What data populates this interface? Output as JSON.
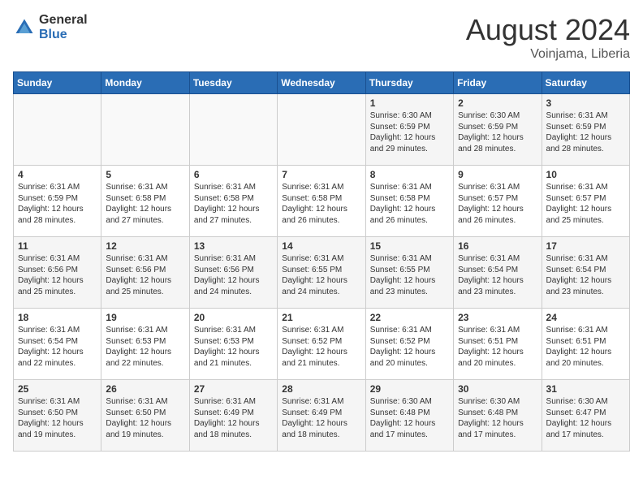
{
  "header": {
    "logo_general": "General",
    "logo_blue": "Blue",
    "title": "August 2024",
    "subtitle": "Voinjama, Liberia"
  },
  "calendar": {
    "days_of_week": [
      "Sunday",
      "Monday",
      "Tuesday",
      "Wednesday",
      "Thursday",
      "Friday",
      "Saturday"
    ],
    "weeks": [
      [
        {
          "day": "",
          "info": ""
        },
        {
          "day": "",
          "info": ""
        },
        {
          "day": "",
          "info": ""
        },
        {
          "day": "",
          "info": ""
        },
        {
          "day": "1",
          "info": "Sunrise: 6:30 AM\nSunset: 6:59 PM\nDaylight: 12 hours\nand 29 minutes."
        },
        {
          "day": "2",
          "info": "Sunrise: 6:30 AM\nSunset: 6:59 PM\nDaylight: 12 hours\nand 28 minutes."
        },
        {
          "day": "3",
          "info": "Sunrise: 6:31 AM\nSunset: 6:59 PM\nDaylight: 12 hours\nand 28 minutes."
        }
      ],
      [
        {
          "day": "4",
          "info": "Sunrise: 6:31 AM\nSunset: 6:59 PM\nDaylight: 12 hours\nand 28 minutes."
        },
        {
          "day": "5",
          "info": "Sunrise: 6:31 AM\nSunset: 6:58 PM\nDaylight: 12 hours\nand 27 minutes."
        },
        {
          "day": "6",
          "info": "Sunrise: 6:31 AM\nSunset: 6:58 PM\nDaylight: 12 hours\nand 27 minutes."
        },
        {
          "day": "7",
          "info": "Sunrise: 6:31 AM\nSunset: 6:58 PM\nDaylight: 12 hours\nand 26 minutes."
        },
        {
          "day": "8",
          "info": "Sunrise: 6:31 AM\nSunset: 6:58 PM\nDaylight: 12 hours\nand 26 minutes."
        },
        {
          "day": "9",
          "info": "Sunrise: 6:31 AM\nSunset: 6:57 PM\nDaylight: 12 hours\nand 26 minutes."
        },
        {
          "day": "10",
          "info": "Sunrise: 6:31 AM\nSunset: 6:57 PM\nDaylight: 12 hours\nand 25 minutes."
        }
      ],
      [
        {
          "day": "11",
          "info": "Sunrise: 6:31 AM\nSunset: 6:56 PM\nDaylight: 12 hours\nand 25 minutes."
        },
        {
          "day": "12",
          "info": "Sunrise: 6:31 AM\nSunset: 6:56 PM\nDaylight: 12 hours\nand 25 minutes."
        },
        {
          "day": "13",
          "info": "Sunrise: 6:31 AM\nSunset: 6:56 PM\nDaylight: 12 hours\nand 24 minutes."
        },
        {
          "day": "14",
          "info": "Sunrise: 6:31 AM\nSunset: 6:55 PM\nDaylight: 12 hours\nand 24 minutes."
        },
        {
          "day": "15",
          "info": "Sunrise: 6:31 AM\nSunset: 6:55 PM\nDaylight: 12 hours\nand 23 minutes."
        },
        {
          "day": "16",
          "info": "Sunrise: 6:31 AM\nSunset: 6:54 PM\nDaylight: 12 hours\nand 23 minutes."
        },
        {
          "day": "17",
          "info": "Sunrise: 6:31 AM\nSunset: 6:54 PM\nDaylight: 12 hours\nand 23 minutes."
        }
      ],
      [
        {
          "day": "18",
          "info": "Sunrise: 6:31 AM\nSunset: 6:54 PM\nDaylight: 12 hours\nand 22 minutes."
        },
        {
          "day": "19",
          "info": "Sunrise: 6:31 AM\nSunset: 6:53 PM\nDaylight: 12 hours\nand 22 minutes."
        },
        {
          "day": "20",
          "info": "Sunrise: 6:31 AM\nSunset: 6:53 PM\nDaylight: 12 hours\nand 21 minutes."
        },
        {
          "day": "21",
          "info": "Sunrise: 6:31 AM\nSunset: 6:52 PM\nDaylight: 12 hours\nand 21 minutes."
        },
        {
          "day": "22",
          "info": "Sunrise: 6:31 AM\nSunset: 6:52 PM\nDaylight: 12 hours\nand 20 minutes."
        },
        {
          "day": "23",
          "info": "Sunrise: 6:31 AM\nSunset: 6:51 PM\nDaylight: 12 hours\nand 20 minutes."
        },
        {
          "day": "24",
          "info": "Sunrise: 6:31 AM\nSunset: 6:51 PM\nDaylight: 12 hours\nand 20 minutes."
        }
      ],
      [
        {
          "day": "25",
          "info": "Sunrise: 6:31 AM\nSunset: 6:50 PM\nDaylight: 12 hours\nand 19 minutes."
        },
        {
          "day": "26",
          "info": "Sunrise: 6:31 AM\nSunset: 6:50 PM\nDaylight: 12 hours\nand 19 minutes."
        },
        {
          "day": "27",
          "info": "Sunrise: 6:31 AM\nSunset: 6:49 PM\nDaylight: 12 hours\nand 18 minutes."
        },
        {
          "day": "28",
          "info": "Sunrise: 6:31 AM\nSunset: 6:49 PM\nDaylight: 12 hours\nand 18 minutes."
        },
        {
          "day": "29",
          "info": "Sunrise: 6:30 AM\nSunset: 6:48 PM\nDaylight: 12 hours\nand 17 minutes."
        },
        {
          "day": "30",
          "info": "Sunrise: 6:30 AM\nSunset: 6:48 PM\nDaylight: 12 hours\nand 17 minutes."
        },
        {
          "day": "31",
          "info": "Sunrise: 6:30 AM\nSunset: 6:47 PM\nDaylight: 12 hours\nand 17 minutes."
        }
      ]
    ]
  }
}
